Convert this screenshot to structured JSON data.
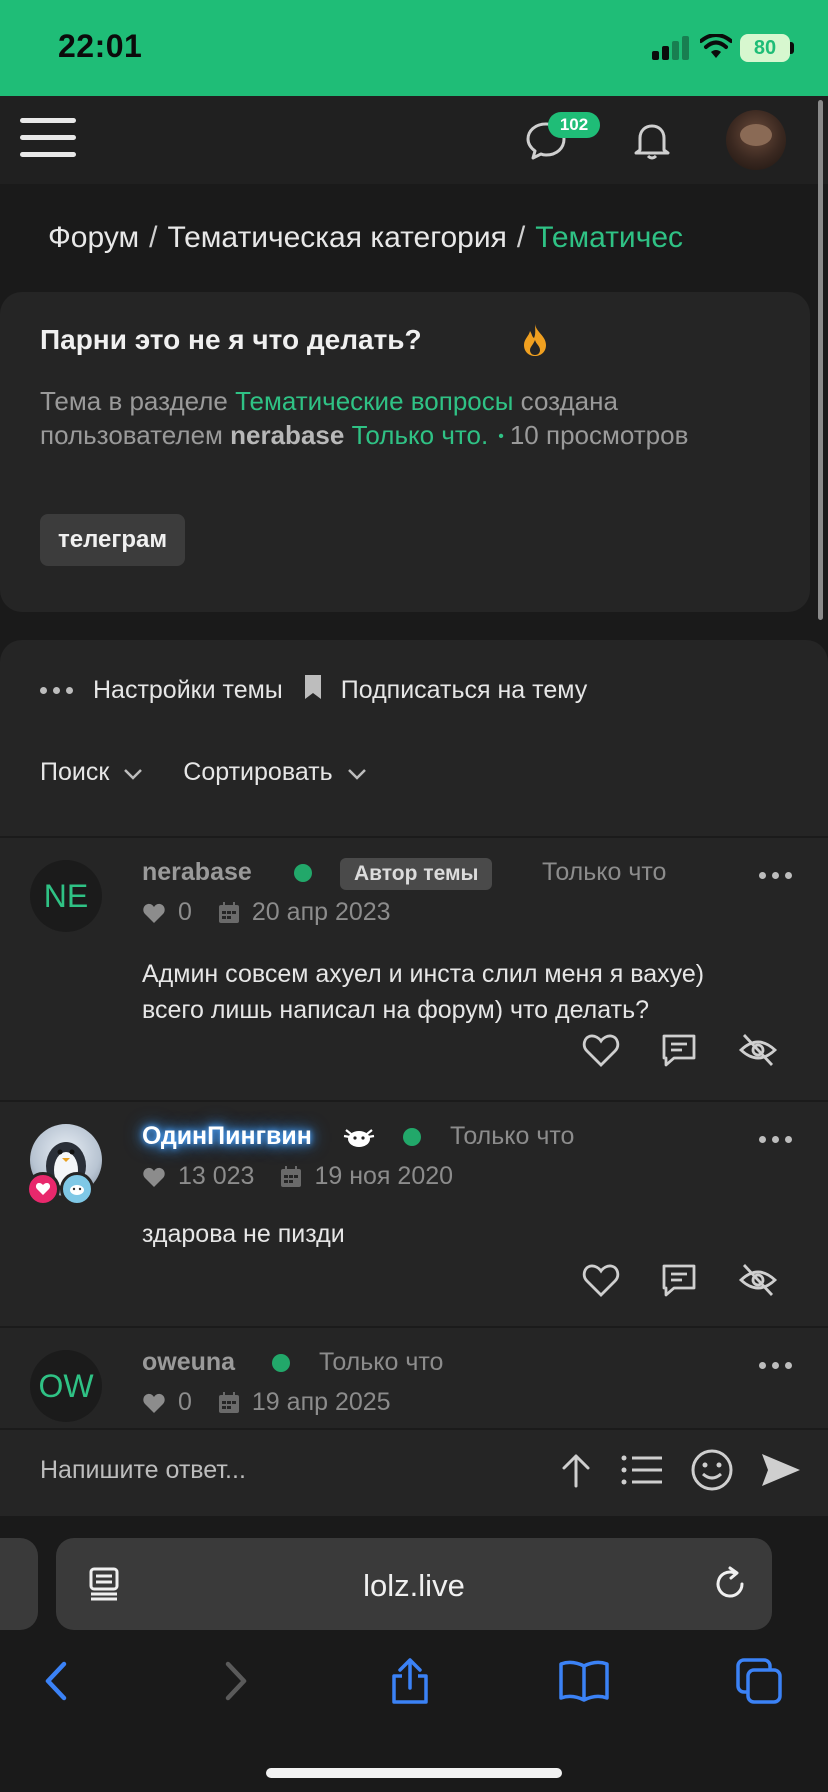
{
  "status_bar": {
    "time": "22:01",
    "battery": "80"
  },
  "nav": {
    "messages_badge": "102"
  },
  "breadcrumb": {
    "items": [
      "Форум",
      "Тематическая категория"
    ],
    "current": "Тематичес",
    "separator": "/"
  },
  "thread": {
    "title": "Парни это не я что делать?",
    "meta_prefix": "Тема в разделе",
    "section": "Тематические вопросы",
    "meta_mid": "создана пользователем",
    "author": "nerabase",
    "time": "Только что.",
    "views_count": "10",
    "views_label": "просмотров",
    "tag": "телеграм"
  },
  "actions": {
    "settings": "Настройки темы",
    "subscribe": "Подписаться на тему",
    "search": "Поиск",
    "sort": "Сортировать"
  },
  "posts": [
    {
      "avatar_initials": "NE",
      "username": "nerabase",
      "badge": "Автор темы",
      "time": "Только что",
      "likes": "0",
      "joined": "20 апр 2023",
      "text_line1": "Админ совсем ахуел и инста слил меня я вахуе)",
      "text_line2": "всего лишь написал на форум) что делать?"
    },
    {
      "username": "ОдинПингвин",
      "time": "Только что",
      "likes": "13 023",
      "joined": "19 ноя 2020",
      "text_line1": "здарова не пизди"
    },
    {
      "avatar_initials": "OW",
      "username": "oweuna",
      "time": "Только что",
      "likes": "0",
      "joined": "19 апр 2025"
    }
  ],
  "reply": {
    "placeholder": "Напишите ответ..."
  },
  "browser": {
    "url": "lolz.live"
  },
  "colors": {
    "accent": "#2fc285",
    "status_bar": "#1fbd77",
    "ios_blue": "#3b82f6"
  }
}
